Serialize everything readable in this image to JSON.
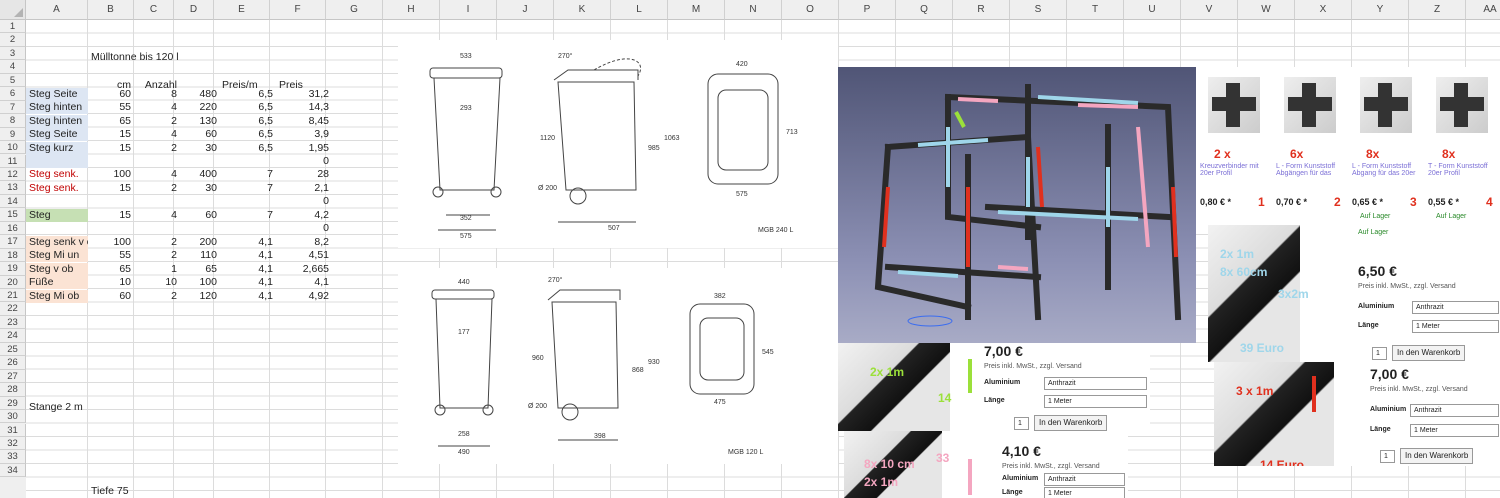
{
  "columns": [
    "A",
    "B",
    "C",
    "D",
    "E",
    "F",
    "G",
    "H",
    "I",
    "J",
    "K",
    "L",
    "M",
    "N",
    "O",
    "P",
    "Q",
    "R",
    "S",
    "T",
    "U",
    "V",
    "W",
    "X",
    "Y",
    "Z",
    "AA"
  ],
  "rows": [
    "1",
    "2",
    "3",
    "4",
    "5",
    "6",
    "7",
    "8",
    "9",
    "10",
    "11",
    "12",
    "13",
    "14",
    "15",
    "16",
    "17",
    "18",
    "19",
    "20",
    "21",
    "22",
    "23",
    "24",
    "25",
    "26",
    "27",
    "28",
    "29",
    "30",
    "31",
    "32",
    "33",
    "34"
  ],
  "cells": {
    "b3": "Mülltonne bis 120 l",
    "b5": "cm",
    "c5": "Anzahl",
    "e5": "Preis/m",
    "f5": "Preis",
    "table": [
      {
        "a": "Steg Seite",
        "b": "60",
        "c": "8",
        "d": "480",
        "e": "6,5",
        "f": "31,2"
      },
      {
        "a": "Steg hinten",
        "b": "55",
        "c": "4",
        "d": "220",
        "e": "6,5",
        "f": "14,3"
      },
      {
        "a": "Steg hinten",
        "b": "65",
        "c": "2",
        "d": "130",
        "e": "6,5",
        "f": "8,45"
      },
      {
        "a": "Steg Seite",
        "b": "15",
        "c": "4",
        "d": "60",
        "e": "6,5",
        "f": "3,9"
      },
      {
        "a": "Steg kurz",
        "b": "15",
        "c": "2",
        "d": "30",
        "e": "6,5",
        "f": "1,95"
      },
      {
        "a": "",
        "b": "",
        "c": "",
        "d": "",
        "e": "",
        "f": "0"
      },
      {
        "a": "Steg senk.",
        "b": "100",
        "c": "4",
        "d": "400",
        "e": "7",
        "f": "28"
      },
      {
        "a": "Steg senk.",
        "b": "15",
        "c": "2",
        "d": "30",
        "e": "7",
        "f": "2,1"
      },
      {
        "a": "",
        "b": "",
        "c": "",
        "d": "",
        "e": "",
        "f": "0"
      },
      {
        "a": "Steg",
        "b": "15",
        "c": "4",
        "d": "60",
        "e": "7",
        "f": "4,2"
      },
      {
        "a": "",
        "b": "",
        "c": "",
        "d": "",
        "e": "",
        "f": "0"
      },
      {
        "a": "Steg senk v o",
        "b": "100",
        "c": "2",
        "d": "200",
        "e": "4,1",
        "f": "8,2"
      },
      {
        "a": "Steg Mi un",
        "b": "55",
        "c": "2",
        "d": "110",
        "e": "4,1",
        "f": "4,51"
      },
      {
        "a": "Steg v ob",
        "b": "65",
        "c": "1",
        "d": "65",
        "e": "4,1",
        "f": "2,665"
      },
      {
        "a": "Füße",
        "b": "10",
        "c": "10",
        "d": "100",
        "e": "4,1",
        "f": "4,1"
      },
      {
        "a": "Steg Mi ob",
        "b": "60",
        "c": "2",
        "d": "120",
        "e": "4,1",
        "f": "4,92"
      }
    ],
    "a28": "Stange 2 m",
    "b34": "Tiefe 75"
  },
  "drawings": {
    "top": {
      "dims": [
        "533",
        "293",
        "1120",
        "352",
        "575",
        "270°",
        "Ø 200",
        "507",
        "985",
        "1063",
        "420",
        "713",
        "575"
      ],
      "label": "MGB 240 L"
    },
    "bottom": {
      "dims": [
        "440",
        "177",
        "960",
        "258",
        "490",
        "270°",
        "Ø 200",
        "398",
        "868",
        "930",
        "382",
        "545",
        "475"
      ],
      "label": "MGB 120 L"
    }
  },
  "products": [
    {
      "count": "2 x",
      "name": "Kreuzverbinder mit 20er Profil",
      "price": "0,80 € *",
      "num": "1"
    },
    {
      "count": "6x",
      "name": "L - Form Kunststoff Abgängen für das",
      "price": "0,70 € *",
      "num": "2"
    },
    {
      "count": "8x",
      "name": "L - Form Kunststoff Abgang für das 20er",
      "price": "0,65 € *",
      "num": "3",
      "stock": "Auf Lager"
    },
    {
      "count": "8x",
      "name": "T - Form Kunststoff 20er Profil",
      "price": "0,55 € *",
      "num": "4",
      "stock": "Auf Lager"
    }
  ],
  "shop_panels": [
    {
      "notes": [
        "2x 1m",
        "8x 60cm",
        "3x2m"
      ],
      "extra": "39 Euro",
      "price": "6,50 €",
      "tax": "Preis inkl. MwSt., zzgl. Versand",
      "material_label": "Aluminium",
      "material": "Anthrazit",
      "length_label": "Länge",
      "length": "1 Meter",
      "qty": "1",
      "cart": "In den Warenkorb",
      "stock": "Auf Lager"
    },
    {
      "notes": [
        "2x 1m"
      ],
      "extra": "14",
      "price": "7,00 €",
      "tax": "Preis inkl. MwSt., zzgl. Versand",
      "material_label": "Aluminium",
      "material": "Anthrazit",
      "length_label": "Länge",
      "length": "1 Meter",
      "qty": "1",
      "cart": "In den Warenkorb"
    },
    {
      "notes": [
        "3 x 1m"
      ],
      "extra": "14 Euro",
      "price": "7,00 €",
      "tax": "Preis inkl. MwSt., zzgl. Versand",
      "material_label": "Aluminium",
      "material": "Anthrazit",
      "length_label": "Länge",
      "length": "1 Meter",
      "qty": "1",
      "cart": "In den Warenkorb"
    },
    {
      "notes": [
        "8x 10 cm",
        "2x 1m"
      ],
      "extra": "33",
      "price": "4,10 €",
      "tax": "Preis inkl. MwSt., zzgl. Versand",
      "material_label": "Aluminium",
      "material": "Anthrazit",
      "length_label": "Länge",
      "length": "1 Meter"
    }
  ],
  "colors": {
    "accent_red": "#e0301e",
    "pink": "#f4a6c0",
    "blue": "#9fd6ea",
    "green": "#9be03a",
    "link": "#7b6fd6"
  }
}
